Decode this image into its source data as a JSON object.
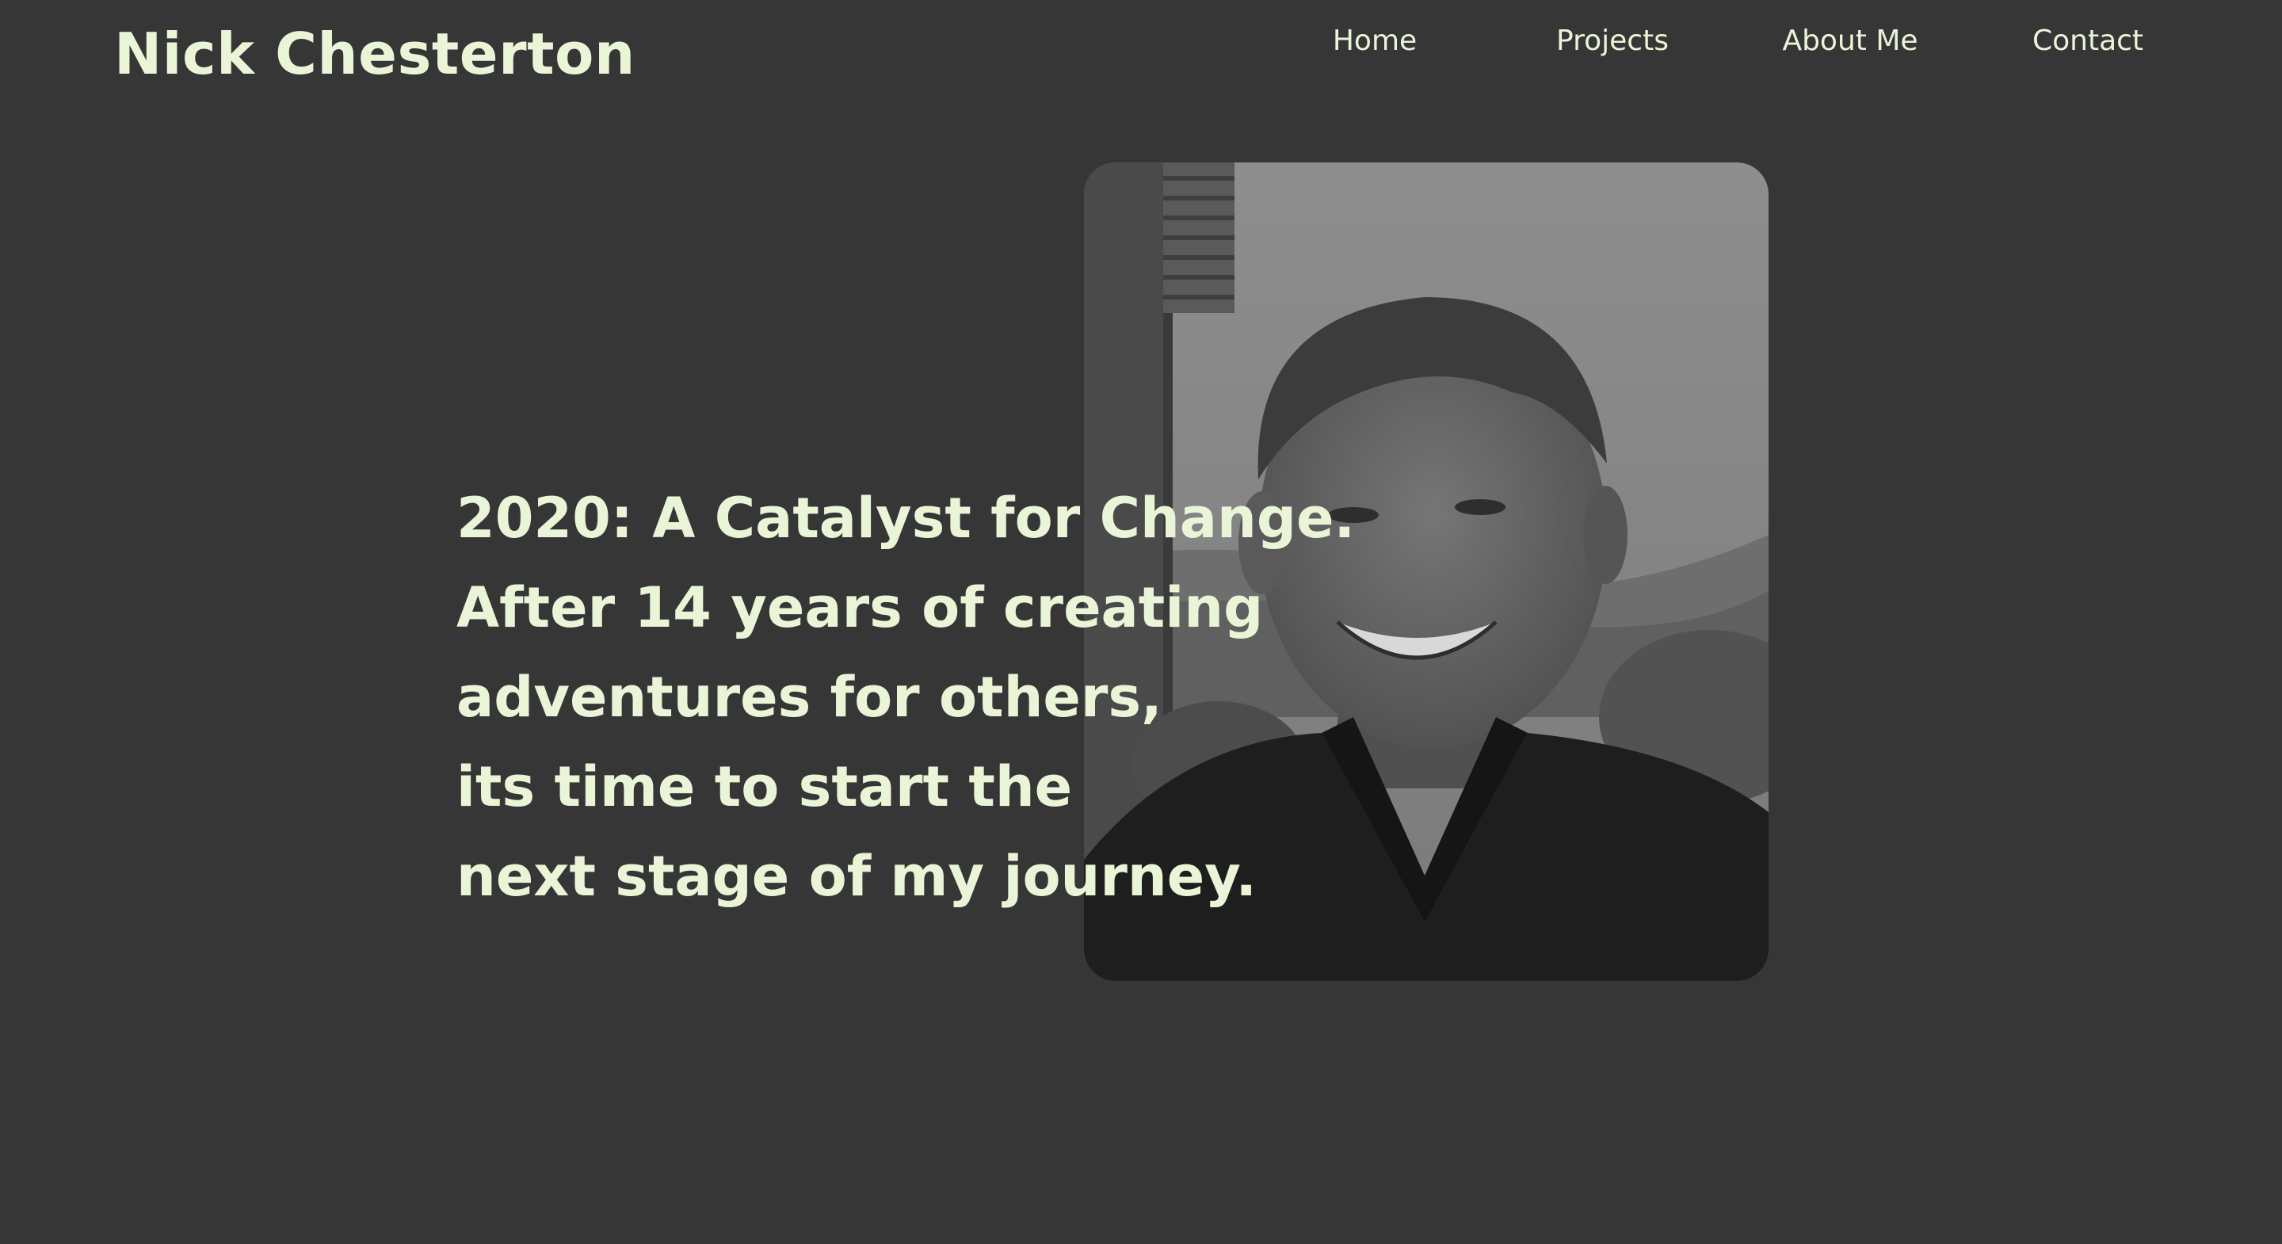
{
  "header": {
    "site_title": "Nick Chesterton"
  },
  "nav": {
    "items": [
      {
        "label": "Home"
      },
      {
        "label": "Projects"
      },
      {
        "label": "About Me"
      },
      {
        "label": "Contact"
      }
    ]
  },
  "hero": {
    "lines": [
      "2020: A Catalyst for Change.",
      "After 14 years of creating",
      "adventures for others,",
      "its time to start the",
      "next stage of my journey."
    ]
  },
  "colors": {
    "background": "#363636",
    "text": "#eaf5d8"
  }
}
